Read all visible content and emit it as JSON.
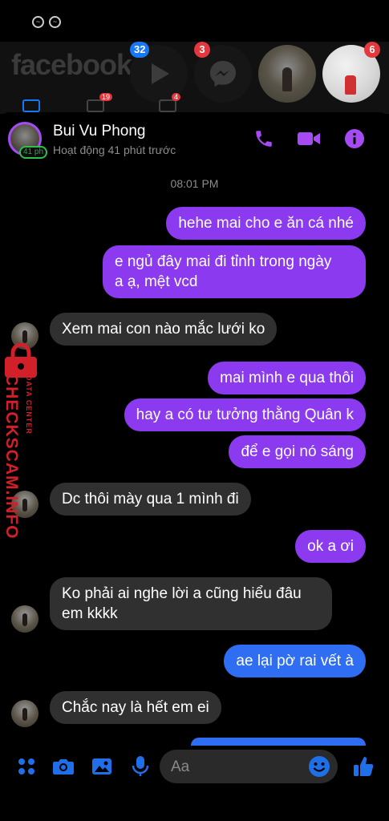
{
  "background": {
    "logo_text": "facebook",
    "badges": {
      "watch": "32",
      "messenger": "3",
      "friend2": "6"
    },
    "tab_badges": [
      "19",
      "4"
    ]
  },
  "header": {
    "name": "Bui Vu Phong",
    "status": "Hoạt động 41 phút trước",
    "active_badge": "41 ph",
    "icons": [
      "phone-icon",
      "video-camera-icon",
      "info-icon"
    ]
  },
  "timestamp": "08:01 PM",
  "messages": [
    {
      "dir": "out",
      "text": "hehe mai cho e ăn cá nhé"
    },
    {
      "dir": "out",
      "text": "e ngủ đây mai đi tỉnh trong ngày\na ạ, mệt vcd"
    },
    {
      "dir": "in",
      "text": "Xem mai con nào mắc lưới ko"
    },
    {
      "dir": "out",
      "text": "mai mình e qua thôi"
    },
    {
      "dir": "out",
      "text": "hay a có tư tưởng thằng Quân k"
    },
    {
      "dir": "out",
      "text": "để e gọi nó sáng"
    },
    {
      "dir": "in",
      "text": "Dc thôi mày qua 1 mình đi"
    },
    {
      "dir": "out",
      "text": "ok a ơi"
    },
    {
      "dir": "in",
      "text": "Ko phải ai nghe lời a cũng hiểu đâu\nem kkkk"
    },
    {
      "dir": "out",
      "text": "ae lại pờ rai vết à"
    },
    {
      "dir": "in",
      "text": "Chắc nay là hết em ei"
    }
  ],
  "watermark": {
    "main": "CHECKSCAM.INFO",
    "sub": "DATA CENTER"
  },
  "composer": {
    "placeholder": "Aa",
    "icons": [
      "grid-icon",
      "camera-icon",
      "image-icon",
      "mic-icon",
      "emoji-icon",
      "thumbs-up-icon"
    ]
  },
  "colors": {
    "outgoing": "#8b3af0",
    "outgoing_blue": "#2f6ef2",
    "incoming": "#303030",
    "accent": "#a64bf4",
    "watermark": "#d1202a"
  }
}
